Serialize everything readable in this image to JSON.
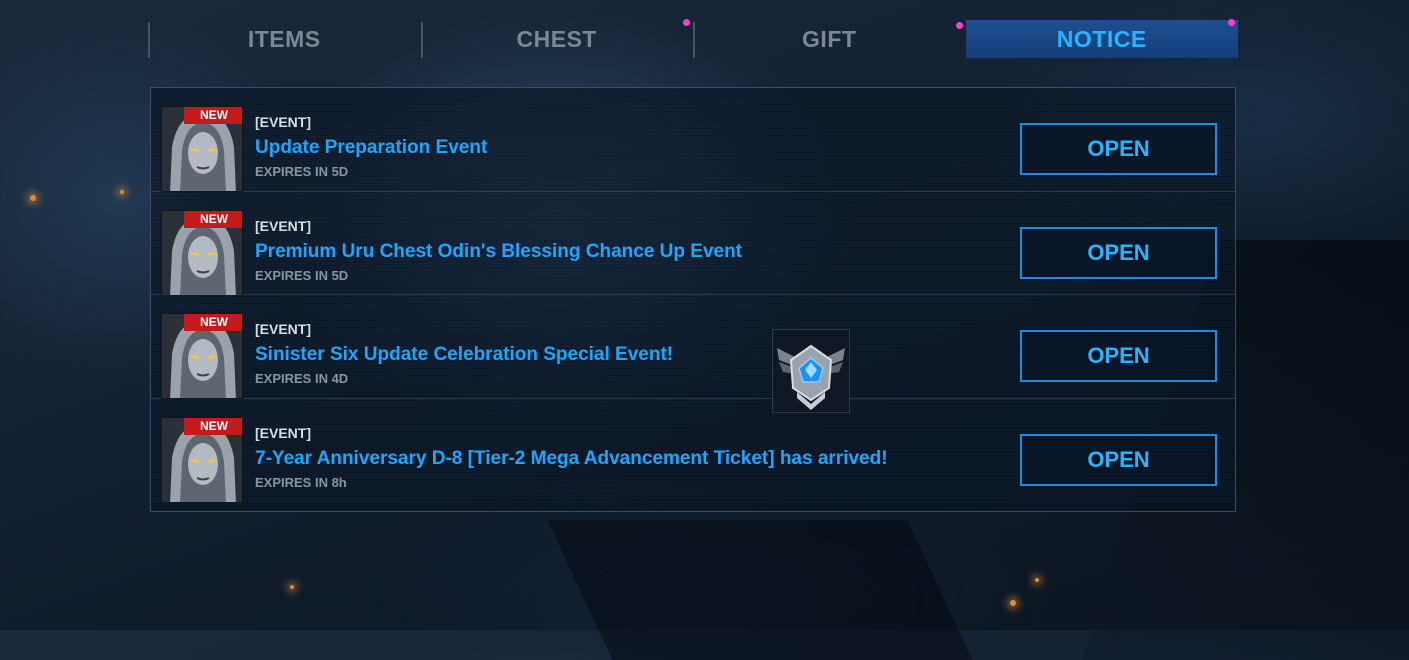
{
  "tabs": [
    {
      "label": "ITEMS",
      "active": false,
      "dot": false
    },
    {
      "label": "CHEST",
      "active": false,
      "dot": true
    },
    {
      "label": "GIFT",
      "active": false,
      "dot": false
    },
    {
      "label": "NOTICE",
      "active": true,
      "dot": true
    }
  ],
  "colors": {
    "accent": "#1ea6ff",
    "active_tab": "#1e4f92",
    "badge_red": "#c41a1a",
    "notification_dot": "#ff3fc8"
  },
  "notices": [
    {
      "badge": "NEW",
      "tag": "[EVENT]",
      "title": "Update Preparation Event",
      "expires": "EXPIRES IN 5D",
      "button": "OPEN",
      "reward_icon": null
    },
    {
      "badge": "NEW",
      "tag": "[EVENT]",
      "title": "Premium Uru Chest Odin's Blessing Chance Up Event",
      "expires": "EXPIRES IN 5D",
      "button": "OPEN",
      "reward_icon": null
    },
    {
      "badge": "NEW",
      "tag": "[EVENT]",
      "title": "Sinister Six Update Celebration Special Event!",
      "expires": "EXPIRES IN 4D",
      "button": "OPEN",
      "reward_icon": null
    },
    {
      "badge": "NEW",
      "tag": "[EVENT]",
      "title": "7-Year Anniversary D-8 [Tier-2 Mega Advancement Ticket] has arrived!",
      "expires": "EXPIRES IN 8h",
      "button": "OPEN",
      "reward_icon": "advancement-ticket-icon"
    }
  ]
}
